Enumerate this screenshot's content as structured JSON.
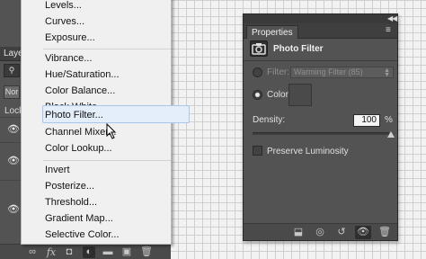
{
  "layers_panel": {
    "tab_label": "Laye",
    "blend_mode_label": "Nor",
    "lock_label": "Lock",
    "footer_fx_label": "fx"
  },
  "adjustment_menu": {
    "items": [
      "Levels...",
      "Curves...",
      "Exposure...",
      "Vibrance...",
      "Hue/Saturation...",
      "Color Balance...",
      "Black  White...",
      "Photo Filter...",
      "Channel Mixer...",
      "Color Lookup...",
      "Invert",
      "Posterize...",
      "Threshold...",
      "Gradient Map...",
      "Selective Color..."
    ],
    "highlighted_item": "Photo Filter..."
  },
  "properties_panel": {
    "tab_label": "Properties",
    "title": "Photo Filter",
    "filter_label": "Filter:",
    "filter_value": "Warming Filter (85)",
    "color_label": "Color:",
    "density_label": "Density:",
    "density_value": "100",
    "density_unit": "%",
    "density_level": 1.0,
    "preserve_luminosity_label": "Preserve Luminosity",
    "preserve_luminosity_checked": false,
    "selected_option": "color"
  },
  "colors": {
    "panel_bg": "#535353",
    "menu_bg": "#f0f0f0",
    "menu_highlight": "#e3eefa",
    "canvas_grid": "#cfcfcf"
  }
}
